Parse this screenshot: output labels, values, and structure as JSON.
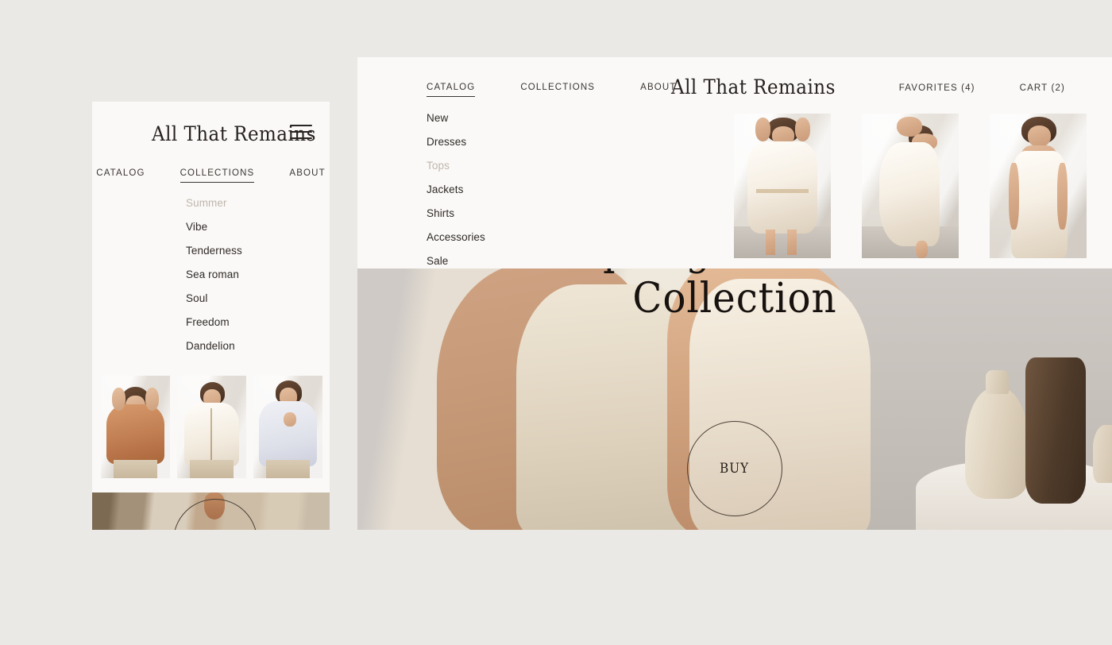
{
  "page": {
    "background_color": "#eae9e5",
    "panel_color": "#faf9f7",
    "text_color": "#2f2a27",
    "muted_color": "#c0b6ac"
  },
  "mobile": {
    "logo": "All That Remains",
    "menu_icon": "hamburger-icon",
    "nav": [
      {
        "label": "CATALOG",
        "active": false
      },
      {
        "label": "COLLECTIONS",
        "active": true
      },
      {
        "label": "ABOUT",
        "active": false
      }
    ],
    "dropdown": [
      {
        "label": "Summer",
        "muted": true
      },
      {
        "label": "Vibe",
        "muted": false
      },
      {
        "label": "Tenderness",
        "muted": false
      },
      {
        "label": "Sea roman",
        "muted": false
      },
      {
        "label": "Soul",
        "muted": false
      },
      {
        "label": "Freedom",
        "muted": false
      },
      {
        "label": "Dandelion",
        "muted": false
      }
    ],
    "thumbnails": [
      {
        "alt": "Model in terracotta linen blouse"
      },
      {
        "alt": "Model in white buttoned blouse"
      },
      {
        "alt": "Model in pale blue blouse"
      }
    ],
    "hero": {
      "alt": "Cropped hero photo with circular buy button"
    }
  },
  "desktop": {
    "logo": "All That Remains",
    "nav": [
      {
        "label": "CATALOG",
        "active": true
      },
      {
        "label": "COLLECTIONS",
        "active": false
      },
      {
        "label": "ABOUT",
        "active": false
      }
    ],
    "utility": [
      {
        "label": "FAVORITES (4)"
      },
      {
        "label": "CART (2)"
      }
    ],
    "dropdown": [
      {
        "label": "New",
        "muted": false
      },
      {
        "label": "Dresses",
        "muted": false
      },
      {
        "label": "Tops",
        "muted": true
      },
      {
        "label": "Jackets",
        "muted": false
      },
      {
        "label": "Shirts",
        "muted": false
      },
      {
        "label": "Accessories",
        "muted": false
      },
      {
        "label": "Sale",
        "muted": false
      }
    ],
    "thumbnails": [
      {
        "alt": "Model in white tiered mini dress"
      },
      {
        "alt": "Model in ivory midi dress posing"
      },
      {
        "alt": "Model in cream slip dress"
      }
    ],
    "hero": {
      "title_line1": "Spring Summer",
      "title_line2": "Collection",
      "buy_label": "BUY",
      "alt": "Two models in slip dresses with ceramic vases"
    }
  }
}
